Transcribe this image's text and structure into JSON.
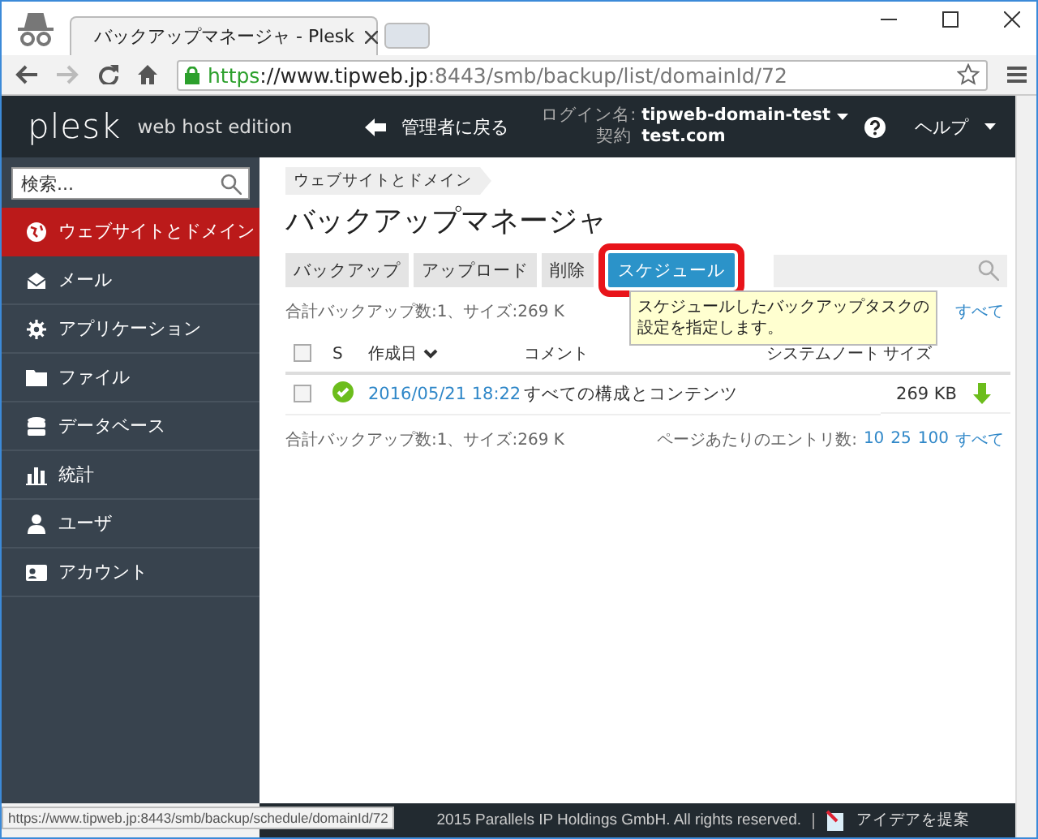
{
  "browser": {
    "tab_title": "バックアップマネージャ - Plesk",
    "address": {
      "scheme": "https",
      "host": "://www.tipweb.jp",
      "rest": ":8443/smb/backup/list/domainId/72"
    },
    "status_url": "https://www.tipweb.jp:8443/smb/backup/schedule/domainId/72"
  },
  "header": {
    "logo": "plesk",
    "edition": "web host edition",
    "back_link": "管理者に戻る",
    "login_label": "ログイン名:",
    "login_user": "tipweb-domain-test",
    "contract_label": "契約",
    "contract": "test.com",
    "help": "ヘルプ"
  },
  "sidebar": {
    "search": {
      "placeholder": "検索..."
    },
    "items": [
      {
        "label": "ウェブサイトとドメイン",
        "kind": "globe",
        "selected": true
      },
      {
        "label": "メール",
        "kind": "mail",
        "selected": false
      },
      {
        "label": "アプリケーション",
        "kind": "gear",
        "selected": false
      },
      {
        "label": "ファイル",
        "kind": "folder",
        "selected": false
      },
      {
        "label": "データベース",
        "kind": "database",
        "selected": false
      },
      {
        "label": "統計",
        "kind": "chart",
        "selected": false
      },
      {
        "label": "ユーザ",
        "kind": "user",
        "selected": false
      },
      {
        "label": "アカウント",
        "kind": "card",
        "selected": false
      }
    ]
  },
  "breadcrumb": "ウェブサイトとドメイン",
  "title": "バックアップマネージャ",
  "toolbar": [
    {
      "label": "バックアップ",
      "selected": false
    },
    {
      "label": "アップロード",
      "selected": false
    },
    {
      "label": "削除",
      "selected": false
    },
    {
      "label": "スケジュール",
      "selected": true
    }
  ],
  "tooltip": "スケジュールしたバックアップタスクの設定を指定します。",
  "summary_top": "合計バックアップ数:1、サイズ:269 K",
  "pagination_top": "すべて",
  "select_all": {
    "checked": false
  },
  "columns": [
    {
      "label": "S"
    },
    {
      "label": "作成日",
      "sorted": true
    },
    {
      "label": "コメント"
    },
    {
      "label": "システムノート"
    },
    {
      "label": "サイズ"
    }
  ],
  "rows": [
    {
      "checked": false,
      "kind": "success",
      "date": "2016/05/21 18:22",
      "comment": "すべての構成とコンテンツ",
      "size": "269 KB"
    }
  ],
  "summary_bottom": "合計バックアップ数:1、サイズ:269 K",
  "pagination": {
    "label": "ページあたりのエントリ数:",
    "options": [
      "10",
      "25",
      "100",
      "すべて"
    ]
  },
  "footer": {
    "copyright": "2015 Parallels IP Holdings GmbH. All rights reserved.",
    "suggest": "アイデアを提案"
  }
}
